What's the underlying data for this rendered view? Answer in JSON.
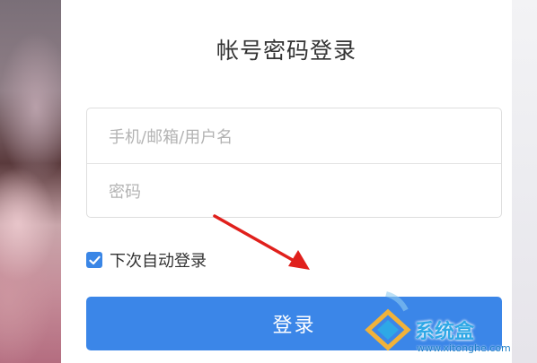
{
  "login": {
    "title": "帐号密码登录",
    "username_placeholder": "手机/邮箱/用户名",
    "password_placeholder": "密码",
    "remember_label": "下次自动登录",
    "remember_checked": true,
    "submit_label": "登录"
  },
  "watermark": {
    "text": "系统盒",
    "url": "www.xitonghe.com"
  },
  "colors": {
    "accent": "#3b86e8",
    "arrow": "#e0201c",
    "title_text": "#333333",
    "placeholder": "#b3b3b3"
  },
  "icons": {
    "checkbox": "check-icon",
    "annotation": "red-arrow-icon",
    "watermark_logo": "xitonghe-logo-icon"
  }
}
